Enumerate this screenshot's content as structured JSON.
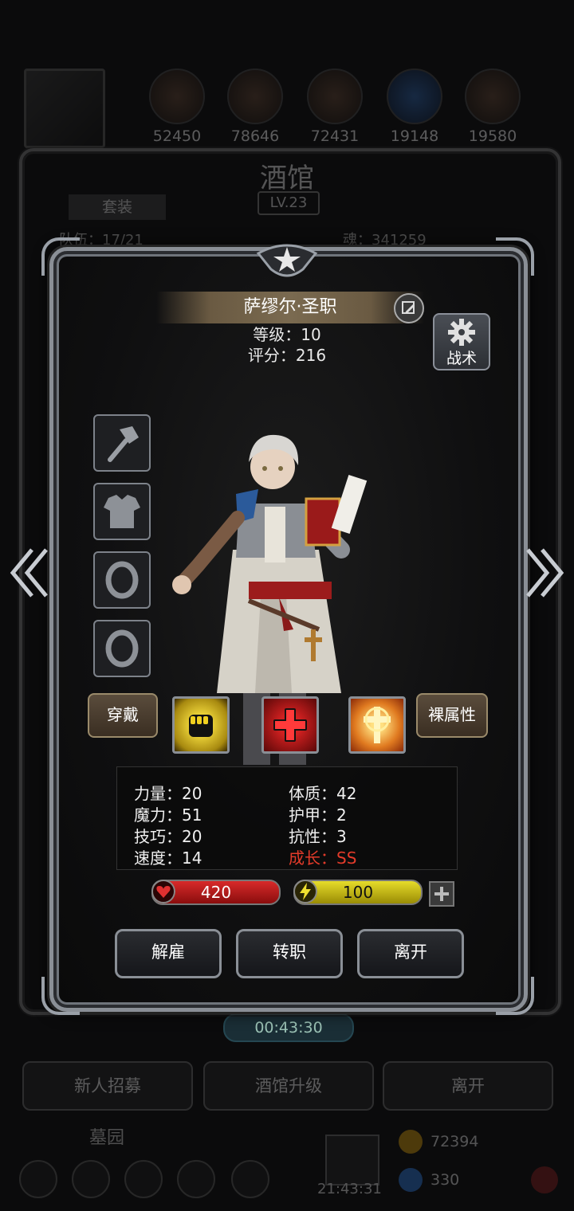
{
  "background": {
    "resources": [
      "52450",
      "78646",
      "72431",
      "19148",
      "19580"
    ],
    "title": "酒馆",
    "level": "LV.23",
    "set_tab": "套装",
    "team_count": "队伍：17/21",
    "soul": "魂：341259",
    "timer": "00:43:30",
    "bottom_buttons": [
      "新人招募",
      "酒馆升级",
      "离开"
    ],
    "graveyard": "墓园",
    "gold": "72394",
    "gems": "330",
    "bottom_timer": "21:43:31"
  },
  "hero": {
    "name": "萨缪尔·圣职",
    "level_line": "等级：10",
    "score_line": "评分：216"
  },
  "tactics": {
    "label": "战术"
  },
  "equipment": {
    "slots": [
      "hammer-icon",
      "armor-icon",
      "ring-icon",
      "ring-icon"
    ]
  },
  "actions": {
    "equip": "穿戴",
    "bare_attr": "裸属性",
    "skills": [
      "fist-skill-icon",
      "heal-cross-skill-icon",
      "holy-light-skill-icon"
    ]
  },
  "stats": {
    "strength": "力量：20",
    "magic": "魔力：51",
    "skill": "技巧：20",
    "speed": "速度：14",
    "constitution": "体质：42",
    "armor": "护甲：2",
    "resist": "抗性：3",
    "growth": "成长：SS",
    "growth_color": "#e33b2a"
  },
  "bars": {
    "hp": "420",
    "energy": "100",
    "hp_color": "#d82a2a",
    "energy_color": "#e6dc2a"
  },
  "buttons": {
    "dismiss": "解雇",
    "change_class": "转职",
    "leave": "离开"
  }
}
